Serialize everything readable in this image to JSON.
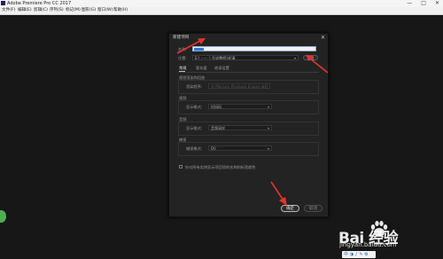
{
  "app": {
    "title": "Adobe Premiere Pro CC 2017",
    "controls": [
      "—",
      "□",
      "✕"
    ]
  },
  "menubar": {
    "items": [
      "文件(F)",
      "编辑(E)",
      "剪辑(C)",
      "序列(S)",
      "标记(M)",
      "图形(G)",
      "窗口(W)",
      "帮助(H)"
    ]
  },
  "dialog": {
    "title": "新建项目",
    "close": "✕",
    "name_label": "名称:",
    "name_value": "",
    "location_label": "位置:",
    "location_value": "E:\\  ······  \\  号说教程(初清",
    "browse_label": "浏览",
    "tabs": [
      "常规",
      "暂存盘",
      "收录设置"
    ],
    "sections": {
      "renderer_heading": "视频渲染和回放",
      "renderer_label": "渲染程序:",
      "renderer_value": "仅 Mercury Playback Engine 软件",
      "video_heading": "视频",
      "video_label": "显示格式:",
      "video_value": "时间码",
      "audio_heading": "音频",
      "audio_label": "显示格式:",
      "audio_value": "音频采样",
      "capture_heading": "捕捉",
      "capture_label": "捕捉格式:",
      "capture_value": "DV"
    },
    "checkbox_label": "针对所有实例显示项目项的名称和标签颜色",
    "ok_label": "确定",
    "cancel_label": "取消"
  },
  "watermark": {
    "text": "Bai 经验",
    "url": "jingyan.baidu.com"
  },
  "ime": {
    "text": "中 ◑ ♪ ✎ ⚙"
  },
  "colors": {
    "accent": "#3875d7",
    "arrow": "#e4342b",
    "dialog_bg": "#232323",
    "workspace": "#171717"
  }
}
